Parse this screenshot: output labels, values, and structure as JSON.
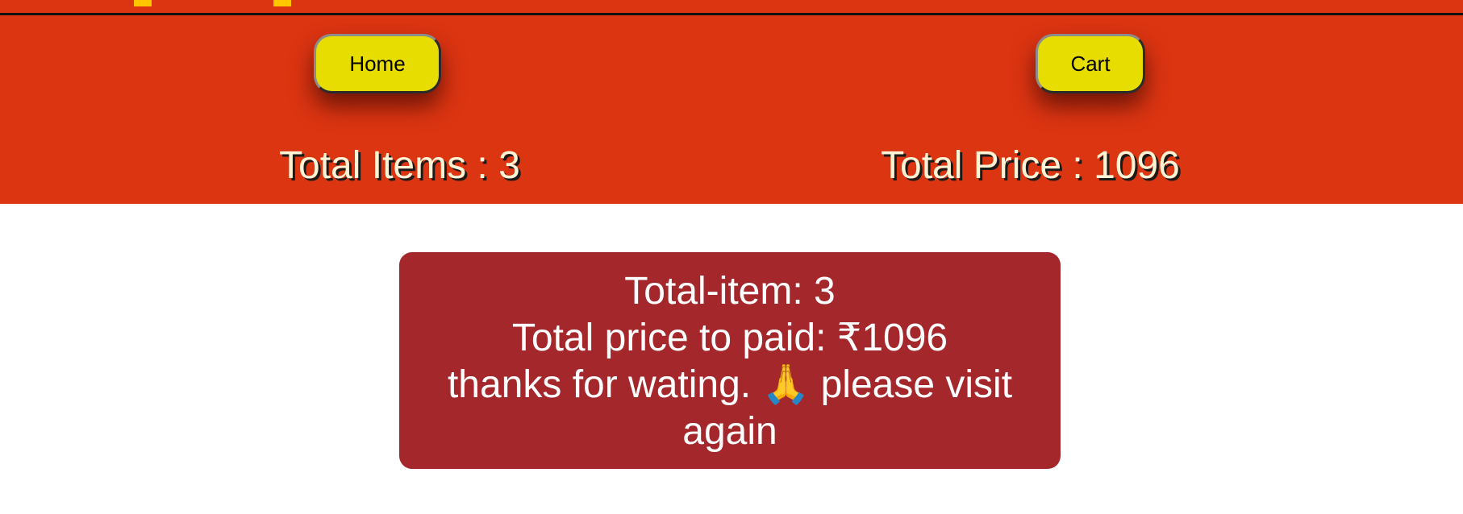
{
  "header": {
    "nav": {
      "home_label": "Home",
      "cart_label": "Cart"
    },
    "total_items": "Total Items : 3",
    "total_price": "Total Price : 1096"
  },
  "summary": {
    "items_line": "Total-item: 3",
    "price_line": "Total price to paid: ₹1096",
    "thanks_before": "thanks for wating.",
    "thanks_emoji": "🙏",
    "thanks_after": "please visit again"
  },
  "colors": {
    "header_bg": "#dc3512",
    "button_bg": "#e8dd00",
    "card_bg": "#a4272c",
    "logo_accent": "#ffc600"
  },
  "icons": {
    "thanks_icon": "folded-hands-icon"
  }
}
